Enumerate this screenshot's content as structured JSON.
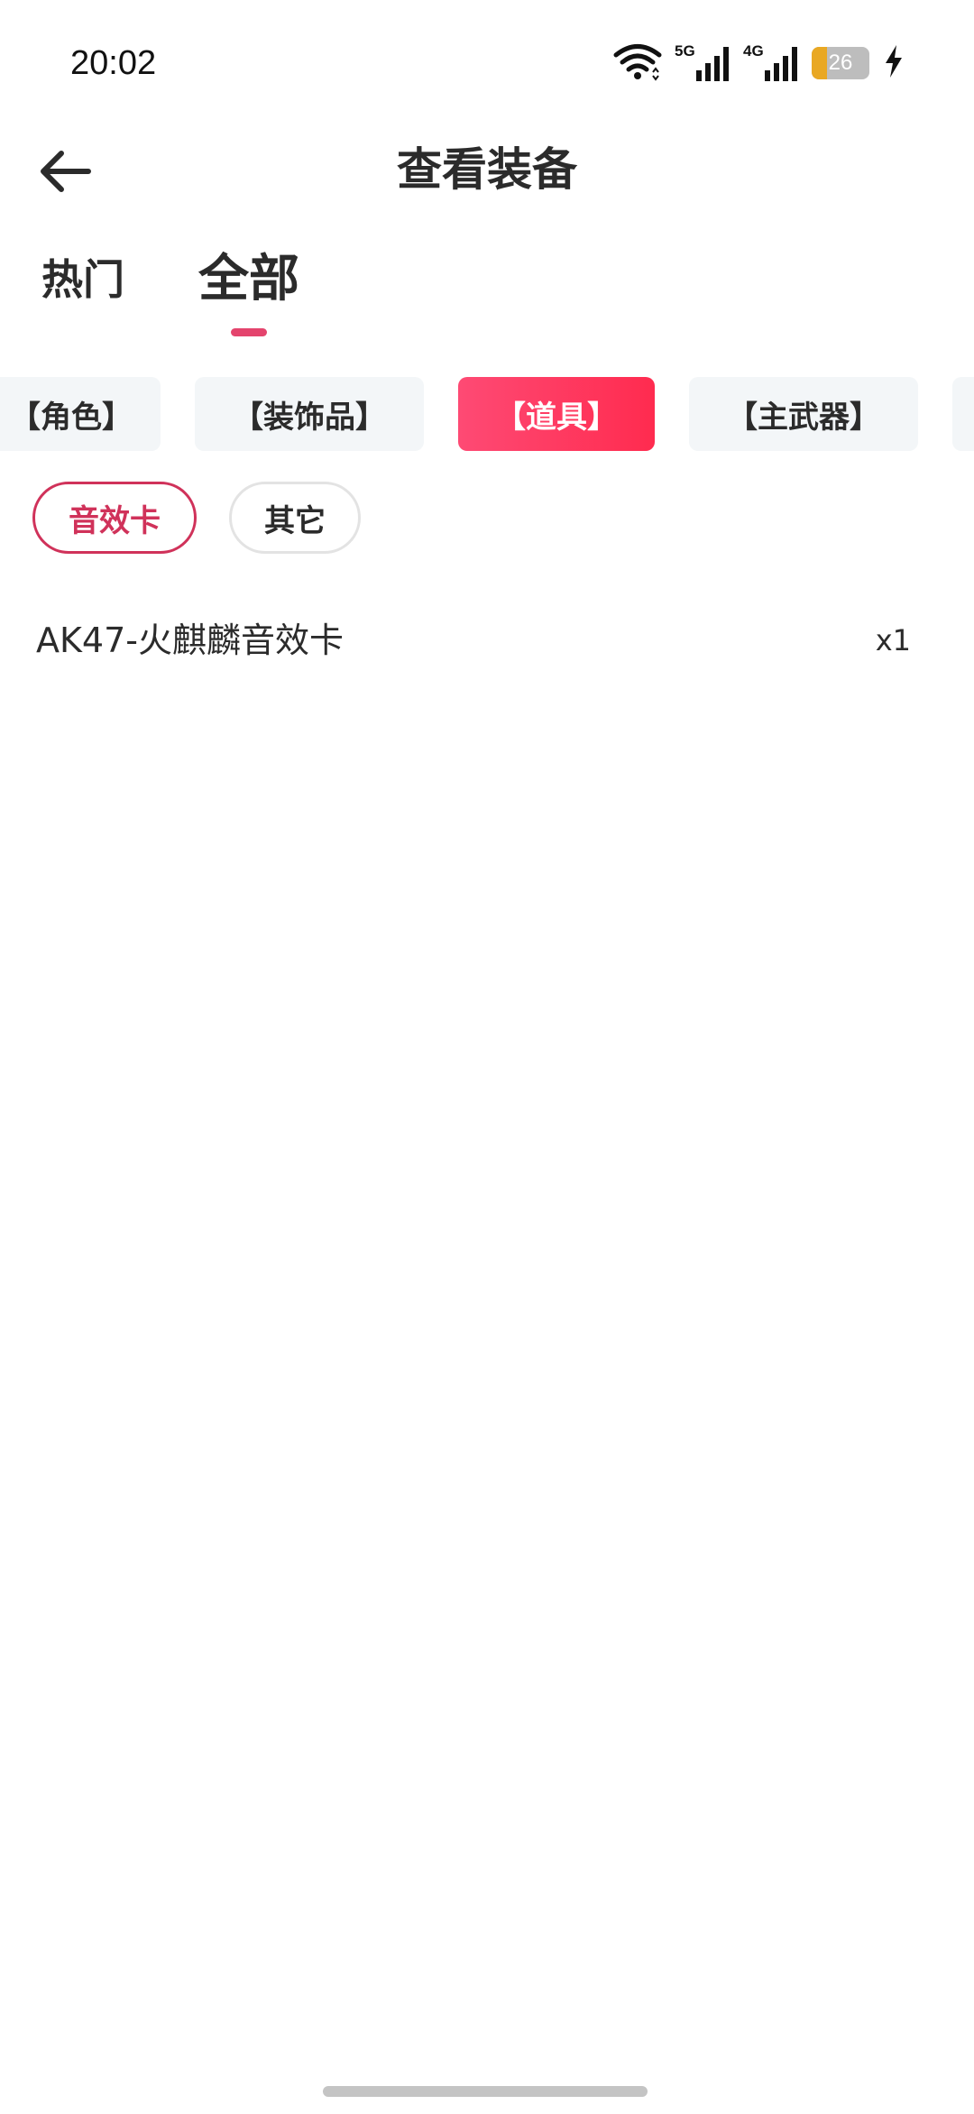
{
  "status_bar": {
    "time": "20:02",
    "network_5g": "5G",
    "network_4g": "4G",
    "battery_level": "26",
    "battery_fraction": 0.26
  },
  "header": {
    "title": "查看装备",
    "back_icon": "arrow-left-icon"
  },
  "main_tabs": [
    {
      "label": "热门",
      "active": false
    },
    {
      "label": "全部",
      "active": true
    }
  ],
  "categories": [
    {
      "label": "【角色】",
      "active": false
    },
    {
      "label": "【装饰品】",
      "active": false
    },
    {
      "label": "【道具】",
      "active": true
    },
    {
      "label": "【主武器】",
      "active": false
    }
  ],
  "sub_filters": [
    {
      "label": "音效卡",
      "active": true
    },
    {
      "label": "其它",
      "active": false
    }
  ],
  "items": [
    {
      "name": "AK47-火麒麟音效卡",
      "quantity": "x1"
    }
  ],
  "colors": {
    "accent": "#e4446d",
    "active_chip_start": "#fe4a74",
    "active_chip_end": "#ff2b4f",
    "sub_active": "#d0325a",
    "chip_bg": "#f3f6f8",
    "battery": "#e9a823"
  }
}
